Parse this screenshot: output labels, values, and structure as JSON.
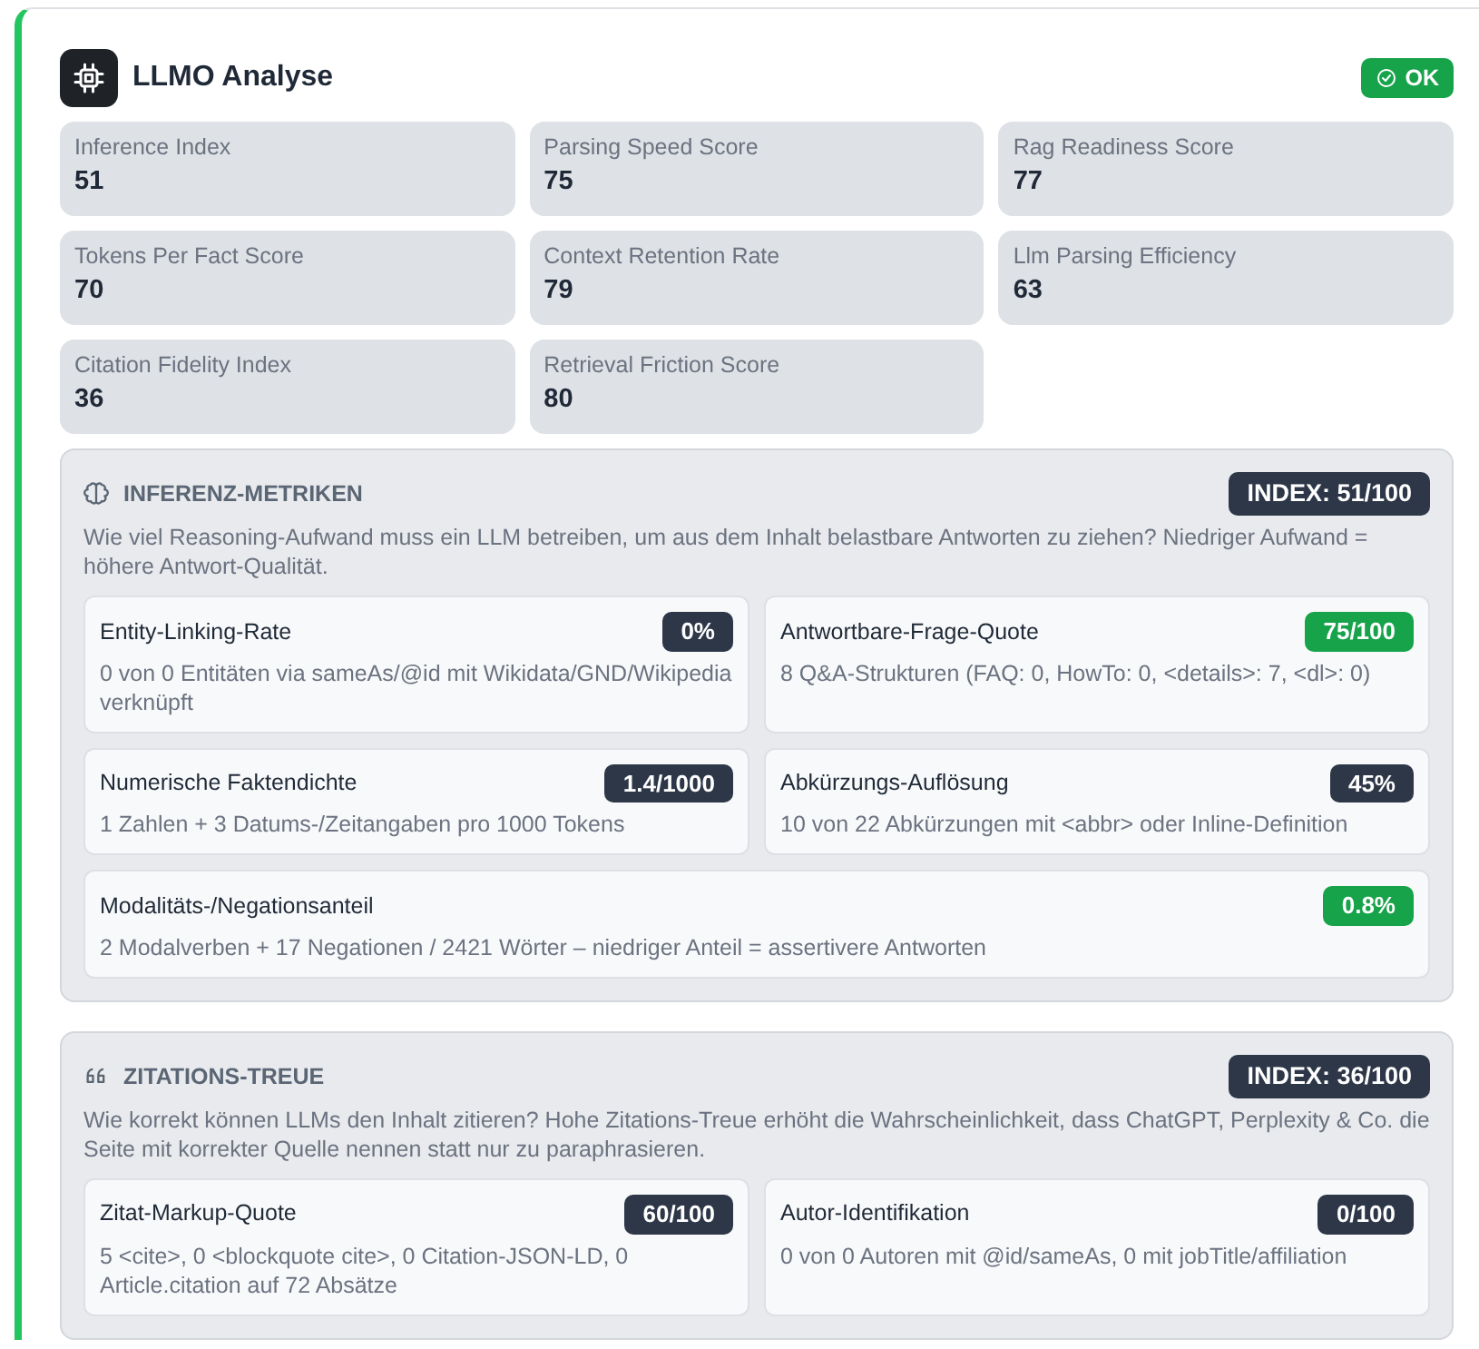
{
  "header": {
    "title": "LLMO Analyse",
    "status": {
      "label": "OK",
      "color": "#16a34a"
    }
  },
  "stats": [
    {
      "label": "Inference Index",
      "value": "51"
    },
    {
      "label": "Parsing Speed Score",
      "value": "75"
    },
    {
      "label": "Rag Readiness Score",
      "value": "77"
    },
    {
      "label": "Tokens Per Fact Score",
      "value": "70"
    },
    {
      "label": "Context Retention Rate",
      "value": "79"
    },
    {
      "label": "Llm Parsing Efficiency",
      "value": "63"
    },
    {
      "label": "Citation Fidelity Index",
      "value": "36"
    },
    {
      "label": "Retrieval Friction Score",
      "value": "80"
    }
  ],
  "sections": [
    {
      "kind": "brain",
      "title": "INFERENZ-METRIKEN",
      "index": "INDEX: 51/100",
      "description": "Wie viel Reasoning-Aufwand muss ein LLM betreiben, um aus dem Inhalt belastbare Antworten zu ziehen? Niedriger Aufwand = höhere Antwort-Qualität.",
      "metrics": [
        {
          "name": "Entity-Linking-Rate",
          "value": "0%",
          "color": "#2d3748",
          "detail": "0 von 0 Entitäten via sameAs/@id mit Wikidata/GND/Wikipedia verknüpft",
          "wide": false
        },
        {
          "name": "Antwortbare-Frage-Quote",
          "value": "75/100",
          "color": "#16a34a",
          "detail": "8 Q&A-Strukturen (FAQ: 0, HowTo: 0, <details>: 7, <dl>: 0)",
          "wide": false
        },
        {
          "name": "Numerische Faktendichte",
          "value": "1.4/1000",
          "color": "#2d3748",
          "detail": "1 Zahlen + 3 Datums-/Zeitangaben pro 1000 Tokens",
          "wide": false
        },
        {
          "name": "Abkürzungs-Auflösung",
          "value": "45%",
          "color": "#2d3748",
          "detail": "10 von 22 Abkürzungen mit <abbr> oder Inline-Definition",
          "wide": false
        },
        {
          "name": "Modalitäts-/Negationsanteil",
          "value": "0.8%",
          "color": "#16a34a",
          "detail": "2 Modalverben + 17 Negationen / 2421 Wörter – niedriger Anteil = assertivere Antworten",
          "wide": true
        }
      ]
    },
    {
      "kind": "quote",
      "title": "ZITATIONS-TREUE",
      "index": "INDEX: 36/100",
      "description": "Wie korrekt können LLMs den Inhalt zitieren? Hohe Zitations-Treue erhöht die Wahrscheinlichkeit, dass ChatGPT, Perplexity & Co. die Seite mit korrekter Quelle nennen statt nur zu paraphrasieren.",
      "metrics": [
        {
          "name": "Zitat-Markup-Quote",
          "value": "60/100",
          "color": "#2d3748",
          "detail": "5 <cite>, 0 <blockquote cite>, 0 Citation-JSON-LD, 0 Article.citation auf 72 Absätze",
          "wide": false
        },
        {
          "name": "Autor-Identifikation",
          "value": "0/100",
          "color": "#2d3748",
          "detail": "0 von 0 Autoren mit @id/sameAs, 0 mit jobTitle/affiliation",
          "wide": false
        }
      ]
    }
  ]
}
